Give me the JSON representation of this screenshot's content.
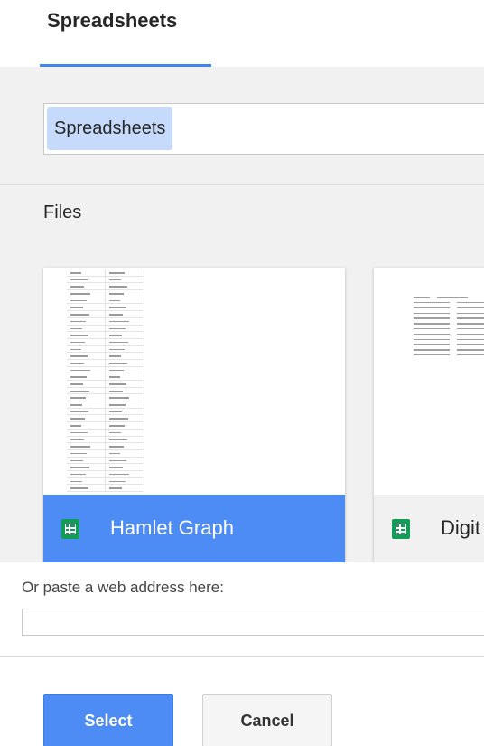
{
  "header": {
    "tab_label": "Spreadsheets"
  },
  "search": {
    "chip_label": "Spreadsheets"
  },
  "files": {
    "section_label": "Files",
    "items": [
      {
        "name": "Hamlet Graph",
        "icon": "spreadsheet-icon",
        "selected": true
      },
      {
        "name": "Digit",
        "icon": "spreadsheet-icon",
        "selected": false
      }
    ]
  },
  "web_address": {
    "label": "Or paste a web address here:",
    "value": ""
  },
  "buttons": {
    "select_label": "Select",
    "cancel_label": "Cancel"
  },
  "colors": {
    "accent": "#4285f4",
    "selected_card": "#4d8cf4",
    "sheets_green": "#0f9d58",
    "panel_bg": "#f1f1f1"
  }
}
